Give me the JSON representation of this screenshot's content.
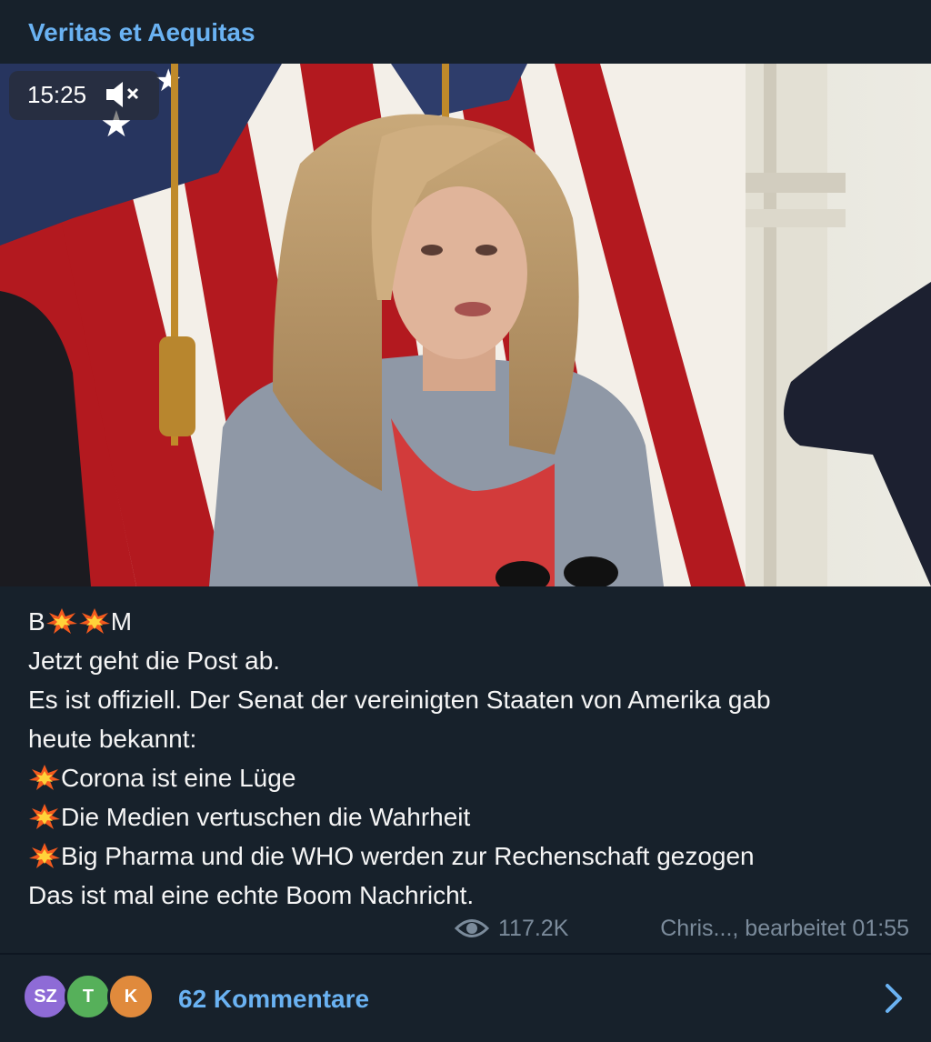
{
  "header": {
    "channel_name": "Veritas et Aequitas"
  },
  "video": {
    "duration": "15:25",
    "muted": true,
    "duration_icon": "muted-speaker-icon"
  },
  "message": {
    "lines": [
      {
        "type": "title",
        "parts": [
          "B",
          "M"
        ]
      },
      {
        "text": "Jetzt geht die Post ab."
      },
      {
        "text": "Es ist offiziell. Der Senat der vereinigten Staaten von Amerika gab"
      },
      {
        "text": "heute bekannt:"
      },
      {
        "bullet": true,
        "text": "Corona ist eine Lüge"
      },
      {
        "bullet": true,
        "text": "Die Medien vertuschen die Wahrheit"
      },
      {
        "bullet": true,
        "text": "Big Pharma und die WHO werden zur Rechenschaft gezogen"
      },
      {
        "text": "Das ist mal eine echte Boom Nachricht."
      }
    ],
    "bullet_icon": "collision-emoji-icon"
  },
  "meta": {
    "views": "117.2K",
    "signature": "Chris..., bearbeitet 01:55",
    "views_icon": "eye-icon"
  },
  "comments": {
    "avatars": [
      {
        "initials": "SZ",
        "color": "#8e6bd6"
      },
      {
        "initials": "T",
        "color": "#56b05a"
      },
      {
        "initials": "K",
        "color": "#e08a3c"
      }
    ],
    "label": "62 Kommentare",
    "chevron_icon": "chevron-right-icon"
  },
  "colors": {
    "background": "#17212b",
    "accent": "#6ab2f2",
    "meta_text": "#7b8b9b"
  }
}
